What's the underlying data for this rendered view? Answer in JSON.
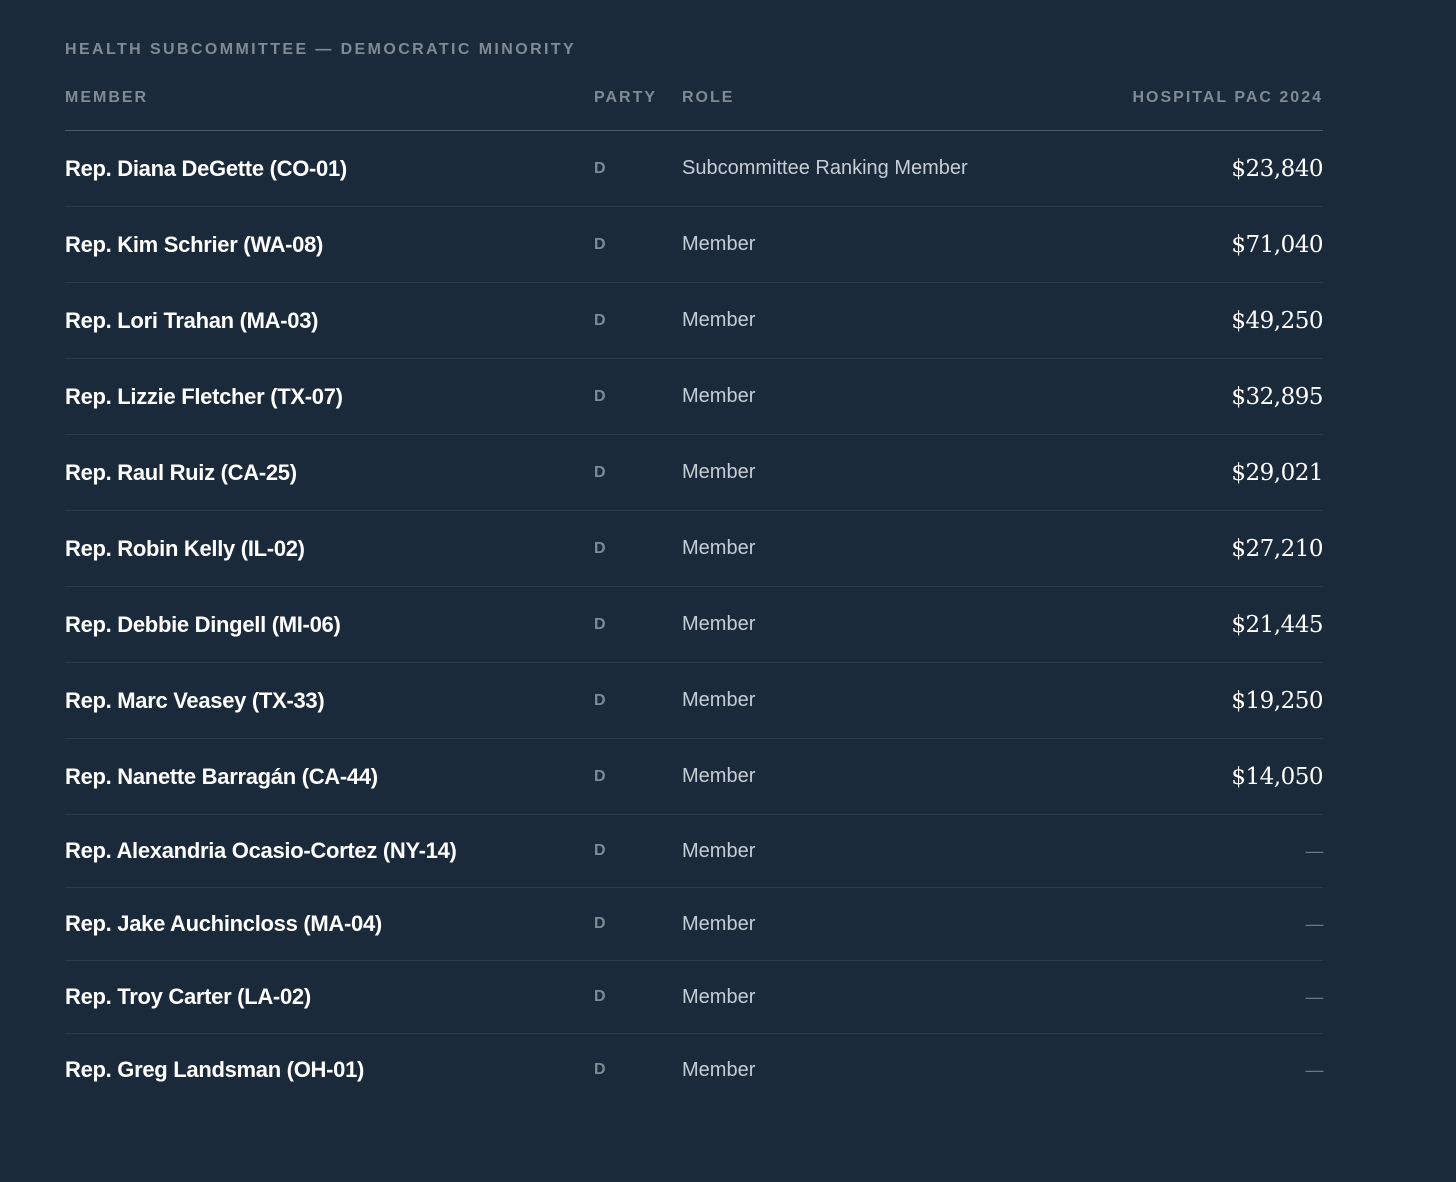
{
  "section_title": "HEALTH SUBCOMMITTEE — DEMOCRATIC MINORITY",
  "columns": {
    "member": "MEMBER",
    "party": "PARTY",
    "role": "ROLE",
    "pac": "HOSPITAL PAC 2024"
  },
  "rows": [
    {
      "member": "Rep. Diana DeGette (CO-01)",
      "party": "D",
      "role": "Subcommittee Ranking Member",
      "pac": "$23,840"
    },
    {
      "member": "Rep. Kim Schrier (WA-08)",
      "party": "D",
      "role": "Member",
      "pac": "$71,040"
    },
    {
      "member": "Rep. Lori Trahan (MA-03)",
      "party": "D",
      "role": "Member",
      "pac": "$49,250"
    },
    {
      "member": "Rep. Lizzie Fletcher (TX-07)",
      "party": "D",
      "role": "Member",
      "pac": "$32,895"
    },
    {
      "member": "Rep. Raul Ruiz (CA-25)",
      "party": "D",
      "role": "Member",
      "pac": "$29,021"
    },
    {
      "member": "Rep. Robin Kelly (IL-02)",
      "party": "D",
      "role": "Member",
      "pac": "$27,210"
    },
    {
      "member": "Rep. Debbie Dingell (MI-06)",
      "party": "D",
      "role": "Member",
      "pac": "$21,445"
    },
    {
      "member": "Rep. Marc Veasey (TX-33)",
      "party": "D",
      "role": "Member",
      "pac": "$19,250"
    },
    {
      "member": "Rep. Nanette Barragán (CA-44)",
      "party": "D",
      "role": "Member",
      "pac": "$14,050"
    },
    {
      "member": "Rep. Alexandria Ocasio-Cortez (NY-14)",
      "party": "D",
      "role": "Member",
      "pac": "—"
    },
    {
      "member": "Rep. Jake Auchincloss (MA-04)",
      "party": "D",
      "role": "Member",
      "pac": "—"
    },
    {
      "member": "Rep. Troy Carter (LA-02)",
      "party": "D",
      "role": "Member",
      "pac": "—"
    },
    {
      "member": "Rep. Greg Landsman (OH-01)",
      "party": "D",
      "role": "Member",
      "pac": "—"
    }
  ]
}
